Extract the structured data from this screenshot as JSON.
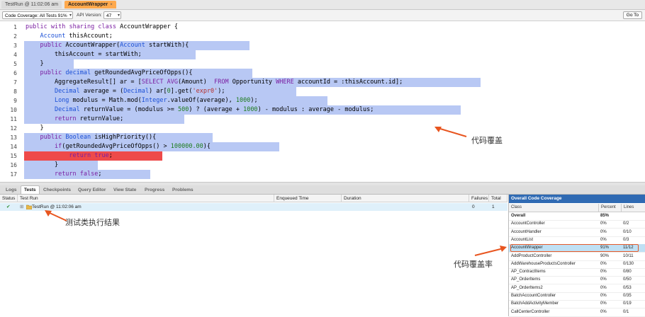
{
  "tabs": {
    "testrun": "TestRun @ 11:02:06 am",
    "account_wrapper": "AccountWrapper",
    "close_glyph": "×"
  },
  "toolbar": {
    "coverage_select": "Code Coverage: All Tests 91%",
    "api_label": "API Version:",
    "api_value": "47",
    "goto": "Go To"
  },
  "editor": {
    "lines": [
      {
        "num": "1",
        "code": "public with sharing class AccountWrapper {"
      },
      {
        "num": "2",
        "code": "    Account thisAccount;"
      },
      {
        "num": "3",
        "code": "    public AccountWrapper(Account startWith){"
      },
      {
        "num": "4",
        "code": "        thisAccount = startWith;"
      },
      {
        "num": "5",
        "code": "    }"
      },
      {
        "num": "6",
        "code": "    public decimal getRoundedAvgPriceOfOpps(){"
      },
      {
        "num": "7",
        "code": "        AggregateResult[] ar = [SELECT AVG(Amount)  FROM Opportunity WHERE accountId = :thisAccount.id];"
      },
      {
        "num": "8",
        "code": "        Decimal average = (Decimal) ar[0].get('expr0');"
      },
      {
        "num": "9",
        "code": "        Long modulus = Math.mod(Integer.valueOf(average), 1000);"
      },
      {
        "num": "10",
        "code": "        Decimal returnValue = (modulus >= 500) ? (average + 1000) - modulus : average - modulus;"
      },
      {
        "num": "11",
        "code": "        return returnValue;"
      },
      {
        "num": "12",
        "code": "    }"
      },
      {
        "num": "13",
        "code": "    public Boolean isHighPriority(){"
      },
      {
        "num": "14",
        "code": "        if(getRoundedAvgPriceOfOpps() > 100000.00){"
      },
      {
        "num": "15",
        "code": "            return true;"
      },
      {
        "num": "16",
        "code": "        }"
      },
      {
        "num": "17",
        "code": "        return false;"
      }
    ]
  },
  "annotations": {
    "code_coverage": "代码覆盖",
    "test_results": "测试类执行结果",
    "coverage_rate": "代码覆盖率"
  },
  "bottom_tabs": [
    "Logs",
    "Tests",
    "Checkpoints",
    "Query Editor",
    "View State",
    "Progress",
    "Problems"
  ],
  "active_bottom_tab": "Tests",
  "tests": {
    "headers": {
      "status": "Status",
      "test_run": "Test Run",
      "enqueued": "Enqueued Time",
      "duration": "Duration",
      "failures": "Failures",
      "total": "Total"
    },
    "row": {
      "status": "✔",
      "expander": "⊞",
      "name": "TestRun @ 11:02:06 am",
      "failures": "0",
      "total": "1"
    }
  },
  "coverage_panel": {
    "title": "Overall Code Coverage",
    "headers": {
      "class": "Class",
      "percent": "Percent",
      "lines": "Lines"
    },
    "rows": [
      {
        "class": "Overall",
        "percent": "85%",
        "lines": ""
      },
      {
        "class": "AccountController",
        "percent": "0%",
        "lines": "0/2"
      },
      {
        "class": "AccountHandler",
        "percent": "0%",
        "lines": "0/10"
      },
      {
        "class": "AccountList",
        "percent": "0%",
        "lines": "0/3"
      },
      {
        "class": "AccountWrapper",
        "percent": "91%",
        "lines": "11/12"
      },
      {
        "class": "AddProductController",
        "percent": "90%",
        "lines": "10/11"
      },
      {
        "class": "AddWarehouseProductsController",
        "percent": "0%",
        "lines": "0/130"
      },
      {
        "class": "AP_ContractItems",
        "percent": "0%",
        "lines": "0/80"
      },
      {
        "class": "AP_OrderItems",
        "percent": "0%",
        "lines": "0/50"
      },
      {
        "class": "AP_OrderItems2",
        "percent": "0%",
        "lines": "0/53"
      },
      {
        "class": "BatchAccountController",
        "percent": "0%",
        "lines": "0/35"
      },
      {
        "class": "BatchAddActivityMember",
        "percent": "0%",
        "lines": "0/19"
      },
      {
        "class": "CallCenterController",
        "percent": "0%",
        "lines": "0/1"
      }
    ]
  },
  "colors": {
    "covered": "#b8c8f4",
    "uncovered": "#ee4a4a",
    "active_tab": "#ffa94d",
    "panel_title": "#2f6ab3",
    "annotation_arrow": "#e8551f",
    "keyword": "#7b1fa2",
    "type": "#1a4fd6",
    "string": "#b5302e",
    "number": "#1d7b1d"
  }
}
